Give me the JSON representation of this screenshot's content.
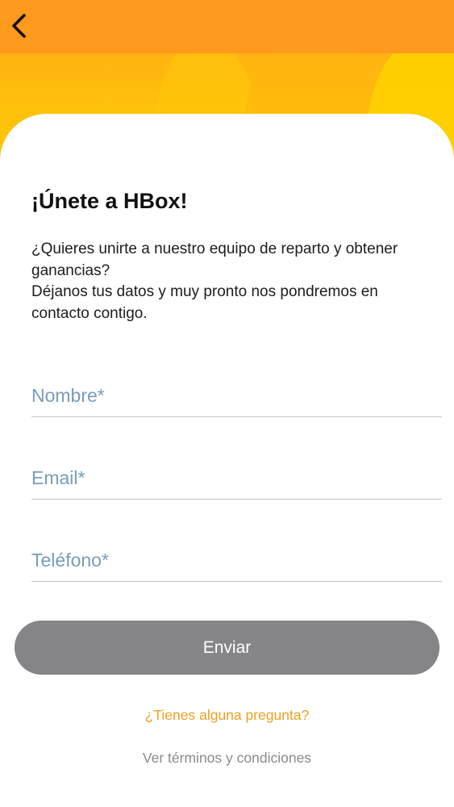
{
  "header": {
    "back_icon": "chevron-left-icon",
    "colors": {
      "orange": "#ff9a1e",
      "yellow": "#ffc608"
    }
  },
  "content": {
    "title": "¡Únete a HBox!",
    "intro_line1": "¿Quieres unirte a nuestro equipo de reparto y obtener ganancias?",
    "intro_line2": "Déjanos tus datos y muy pronto nos pondremos en contacto contigo."
  },
  "form": {
    "name": {
      "placeholder": "Nombre*",
      "value": ""
    },
    "email": {
      "placeholder": "Email*",
      "value": ""
    },
    "phone": {
      "placeholder": "Teléfono*",
      "value": ""
    },
    "submit_label": "Enviar",
    "submit_color": "#858486"
  },
  "footer": {
    "question_link": "¿Tienes alguna pregunta?",
    "question_color": "#f0a020",
    "terms_link": "Ver términos y condiciones"
  }
}
